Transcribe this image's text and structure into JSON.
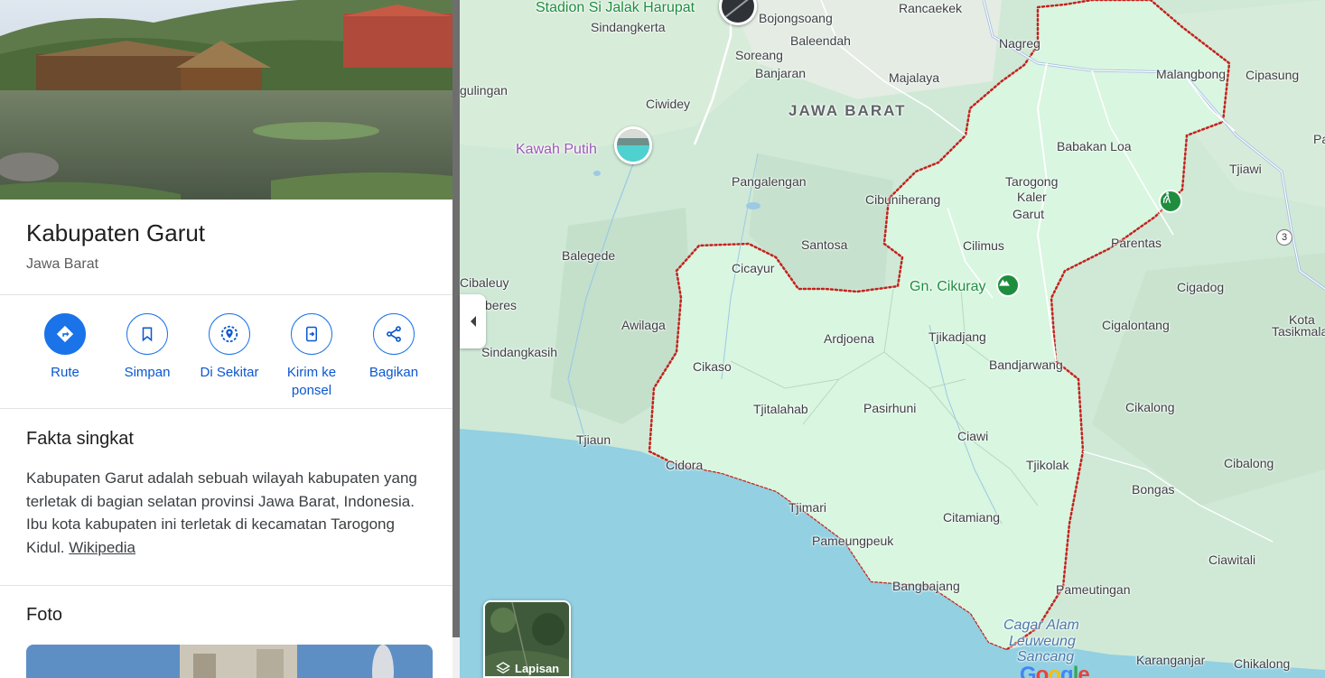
{
  "place": {
    "title": "Kabupaten Garut",
    "subtitle": "Jawa Barat"
  },
  "actions": [
    {
      "label": "Rute",
      "icon": "directions-icon"
    },
    {
      "label": "Simpan",
      "icon": "bookmark-icon"
    },
    {
      "label": "Di Sekitar",
      "icon": "nearby-icon"
    },
    {
      "label": "Kirim ke ponsel",
      "icon": "send-to-phone-icon"
    },
    {
      "label": "Bagikan",
      "icon": "share-icon"
    }
  ],
  "facts": {
    "heading": "Fakta singkat",
    "text": "Kabupaten Garut adalah sebuah wilayah kabupaten yang terletak di bagian selatan provinsi Jawa Barat, Indonesia. Ibu kota kabupaten ini terletak di kecamatan Tarogong Kidul.",
    "link": "Wikipedia"
  },
  "photos": {
    "heading": "Foto"
  },
  "map": {
    "region": "JAWA BARAT",
    "places": {
      "stadion": "Stadion Si Jalak Harupat",
      "bojongsoang": "Bojongsoang",
      "rancaekek": "Rancaekek",
      "sindangkerta": "Sindangkerta",
      "baleendah": "Baleendah",
      "soreang": "Soreang",
      "banjaran": "Banjaran",
      "nagreg": "Nagreg",
      "majalaya": "Majalaya",
      "malangbong": "Malangbong",
      "cipasung": "Cipasung",
      "gulingan": "gulingan",
      "ciwidey": "Ciwidey",
      "kawahputih": "Kawah Putih",
      "babakanloa": "Babakan Loa",
      "pa": "Pa",
      "tjiawi": "Tjiawi",
      "pangalengan": "Pangalengan",
      "tarogong": "Tarogong",
      "kaler": "Kaler",
      "garut": "Garut",
      "cibuniherang": "Cibuniherang",
      "parentas": "Parentas",
      "santosa": "Santosa",
      "cilimus": "Cilimus",
      "balegede": "Balegede",
      "cicayur": "Cicayur",
      "cibaleuy": "Cibaleuy",
      "gncikuray": "Gn. Cikuray",
      "cigadog": "Cigadog",
      "koleberes": "Koleberes",
      "cigalontang": "Cigalontang",
      "kota": "Kota",
      "tasikmala": "Tasikmala",
      "awilaga": "Awilaga",
      "ardjoena": "Ardjoena",
      "tjikadjang": "Tjikadjang",
      "sindangkasih": "Sindangkasih",
      "bandjarwang": "Bandjarwang",
      "cikaso": "Cikaso",
      "tjitalahab": "Tjitalahab",
      "pasirhuni": "Pasirhuni",
      "cikalong": "Cikalong",
      "ciawi": "Ciawi",
      "tjiaun": "Tjiaun",
      "cidora": "Cidora",
      "tjikolak": "Tjikolak",
      "cibalong": "Cibalong",
      "bongas": "Bongas",
      "tjimari": "Tjimari",
      "citamiang": "Citamiang",
      "pameungpeuk": "Pameungpeuk",
      "ciawitali": "Ciawitali",
      "bangbajang": "Bangbajang",
      "pameutingan": "Pameutingan",
      "cagaralam": "Cagar Alam",
      "leuweung": "Leuweung",
      "sancang": "Sancang",
      "karanganjar": "Karanganjar",
      "chikalong": "Chikalong"
    },
    "road_number": "3",
    "layers_label": "Lapisan",
    "google": [
      "G",
      "o",
      "o",
      "g",
      "l",
      "e"
    ]
  },
  "colors": {
    "accent": "#1a73e8",
    "land": "#cfe9d6",
    "highlight": "#d8f6e0",
    "water": "#92d0e2",
    "boundary": "#c5221f",
    "poi_green": "#1e8e3e"
  }
}
